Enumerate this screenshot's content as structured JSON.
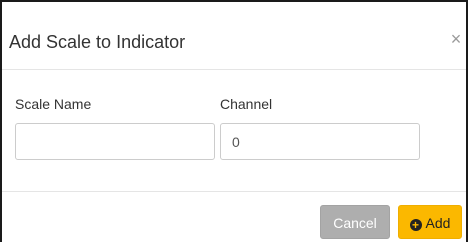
{
  "dialog": {
    "title": "Add Scale to Indicator",
    "close_label": "×"
  },
  "form": {
    "scale_name": {
      "label": "Scale Name",
      "value": "",
      "placeholder": ""
    },
    "channel": {
      "label": "Channel",
      "value": "0",
      "placeholder": ""
    }
  },
  "footer": {
    "cancel_label": "Cancel",
    "add_label": "Add",
    "add_icon": "plus-circle-icon"
  },
  "colors": {
    "add_button": "#fbb800",
    "cancel_button": "#aeaeae"
  }
}
